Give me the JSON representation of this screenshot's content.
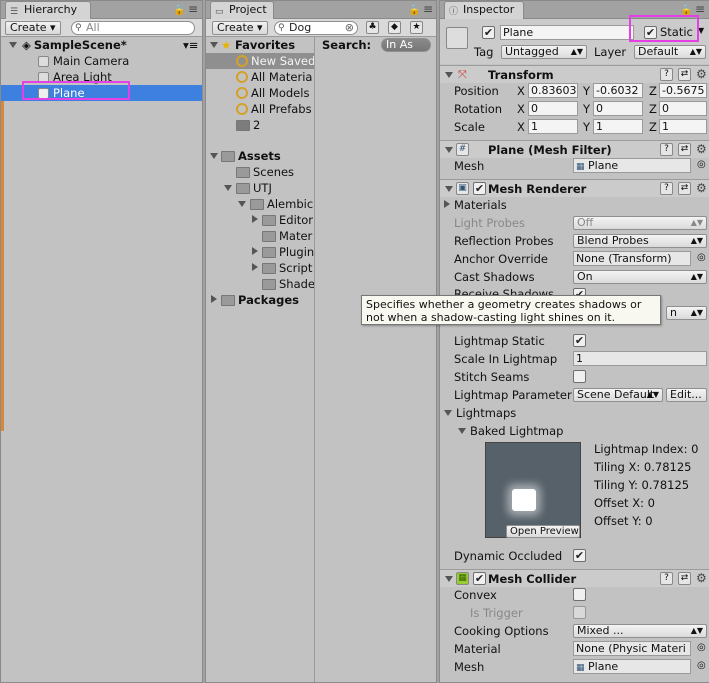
{
  "hierarchy": {
    "tab": "Hierarchy",
    "create": "Create",
    "search_placeholder": "All",
    "scene": "SampleScene*",
    "items": [
      {
        "label": "Main Camera"
      },
      {
        "label": "Area Light"
      },
      {
        "label": "Plane"
      }
    ]
  },
  "project": {
    "tab": "Project",
    "create": "Create",
    "search_value": "Dog",
    "favorites": "Favorites",
    "fav_items": [
      "New Saved",
      "All Materia",
      "All Models",
      "All Prefabs",
      "2"
    ],
    "assets": "Assets",
    "asset_items": [
      "Scenes",
      "UTJ",
      "Alembic",
      "Editor",
      "Mater",
      "Plugin",
      "Script",
      "Shade"
    ],
    "packages": "Packages",
    "search_label": "Search:",
    "search_scope": "In As"
  },
  "inspector": {
    "tab": "Inspector",
    "object_name": "Plane",
    "static_label": "Static",
    "tag_label": "Tag",
    "tag_value": "Untagged",
    "layer_label": "Layer",
    "layer_value": "Default",
    "transform": {
      "title": "Transform",
      "position_label": "Position",
      "rotation_label": "Rotation",
      "scale_label": "Scale",
      "x": "X",
      "y": "Y",
      "z": "Z",
      "position": [
        "0.83603",
        "-0.6032",
        "-0.5675"
      ],
      "rotation": [
        "0",
        "0",
        "0"
      ],
      "scale": [
        "1",
        "1",
        "1"
      ]
    },
    "mesh_filter": {
      "title": "Plane (Mesh Filter)",
      "mesh_label": "Mesh",
      "mesh_value": "Plane"
    },
    "mesh_renderer": {
      "title": "Mesh Renderer",
      "materials": "Materials",
      "light_probes_label": "Light Probes",
      "light_probes_value": "Off",
      "reflection_label": "Reflection Probes",
      "reflection_value": "Blend Probes",
      "anchor_label": "Anchor Override",
      "anchor_value": "None (Transform)",
      "cast_label": "Cast Shadows",
      "cast_value": "On",
      "receive_label": "Receive Shadows",
      "hidden_dd": "n",
      "lm_static_label": "Lightmap Static",
      "scale_lm_label": "Scale In Lightmap",
      "scale_lm_value": "1",
      "stitch_label": "Stitch Seams",
      "lm_param_label": "Lightmap Parameter",
      "lm_param_value": "Scene Default",
      "edit_label": "Edit...",
      "lightmaps": "Lightmaps",
      "baked": "Baked Lightmap",
      "lm_index": "Lightmap Index: 0",
      "tiling_x": "Tiling X: 0.78125",
      "tiling_y": "Tiling Y: 0.78125",
      "offset_x": "Offset X: 0",
      "offset_y": "Offset Y: 0",
      "open_preview": "Open Preview",
      "dyn_occ_label": "Dynamic Occluded"
    },
    "mesh_collider": {
      "title": "Mesh Collider",
      "convex_label": "Convex",
      "trigger_label": "Is Trigger",
      "cooking_label": "Cooking Options",
      "cooking_value": "Mixed ...",
      "material_label": "Material",
      "material_value": "None (Physic Materi",
      "mesh_label": "Mesh",
      "mesh_value": "Plane"
    }
  },
  "tooltip": "Specifies whether a geometry creates shadows or not when a shadow-casting light shines on it.",
  "colors": {
    "selection": "#3d80df",
    "highlight": "#e540e5"
  }
}
